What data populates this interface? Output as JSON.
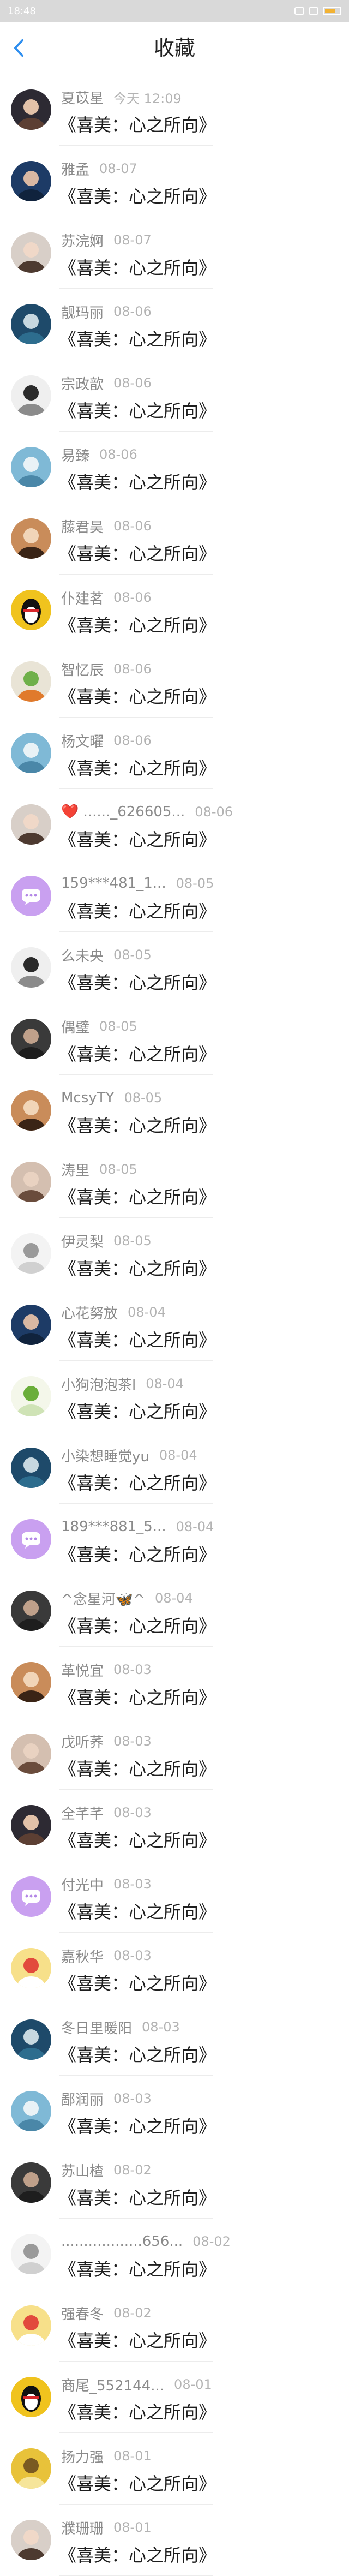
{
  "status_bar": {
    "time": "18:48"
  },
  "nav": {
    "title": "收藏"
  },
  "colors": {
    "accent": "#2f8fef",
    "qq_purple": "#c9a0f0"
  },
  "items": [
    {
      "name": "夏苡星",
      "time": "今天 12:09",
      "title": "《喜美：心之所向》",
      "avatar": "photo-person-icon"
    },
    {
      "name": "雅孟",
      "time": "08-07",
      "title": "《喜美：心之所向》",
      "avatar": "photo-person-icon"
    },
    {
      "name": "苏浣婀",
      "time": "08-07",
      "title": "《喜美：心之所向》",
      "avatar": "photo-person-icon"
    },
    {
      "name": "靓玛丽",
      "time": "08-06",
      "title": "《喜美：心之所向》",
      "avatar": "photo-person-icon"
    },
    {
      "name": "宗政歆",
      "time": "08-06",
      "title": "《喜美：心之所向》",
      "avatar": "photo-person-icon"
    },
    {
      "name": "易臻",
      "time": "08-06",
      "title": "《喜美：心之所向》",
      "avatar": "photo-sea-icon"
    },
    {
      "name": "藤君昊",
      "time": "08-06",
      "title": "《喜美：心之所向》",
      "avatar": "photo-person-icon"
    },
    {
      "name": "仆建茗",
      "time": "08-06",
      "title": "《喜美：心之所向》",
      "avatar": "qq-penguin-icon"
    },
    {
      "name": "智忆辰",
      "time": "08-06",
      "title": "《喜美：心之所向》",
      "avatar": "photo-logo-icon"
    },
    {
      "name": "杨文曜",
      "time": "08-06",
      "title": "《喜美：心之所向》",
      "avatar": "photo-sea-icon"
    },
    {
      "name": "❤️ ......_626605...",
      "time": "08-06",
      "title": "《喜美：心之所向》",
      "avatar": "photo-person-icon"
    },
    {
      "name": "159***481_1...",
      "time": "08-05",
      "title": "《喜美：心之所向》",
      "avatar": "chat-bubble-icon"
    },
    {
      "name": "么未央",
      "time": "08-05",
      "title": "《喜美：心之所向》",
      "avatar": "photo-person-icon"
    },
    {
      "name": "偶璧",
      "time": "08-05",
      "title": "《喜美：心之所向》",
      "avatar": "photo-person-icon"
    },
    {
      "name": "McsyTY",
      "time": "08-05",
      "title": "《喜美：心之所向》",
      "avatar": "photo-person-icon"
    },
    {
      "name": "涛里",
      "time": "08-05",
      "title": "《喜美：心之所向》",
      "avatar": "photo-person-icon"
    },
    {
      "name": "伊灵梨",
      "time": "08-05",
      "title": "《喜美：心之所向》",
      "avatar": "photo-sketch-icon"
    },
    {
      "name": "心花努放",
      "time": "08-04",
      "title": "《喜美：心之所向》",
      "avatar": "photo-person-icon"
    },
    {
      "name": "小狗泡泡茶l",
      "time": "08-04",
      "title": "《喜美：心之所向》",
      "avatar": "photo-plant-icon"
    },
    {
      "name": "小染想睡觉yu",
      "time": "08-04",
      "title": "《喜美：心之所向》",
      "avatar": "photo-person-icon"
    },
    {
      "name": "189***881_5...",
      "time": "08-04",
      "title": "《喜美：心之所向》",
      "avatar": "chat-bubble-icon"
    },
    {
      "name": "^念星河🦋^",
      "time": "08-04",
      "title": "《喜美：心之所向》",
      "avatar": "photo-person-icon"
    },
    {
      "name": "革悦宜",
      "time": "08-03",
      "title": "《喜美：心之所向》",
      "avatar": "photo-person-icon"
    },
    {
      "name": "戊听荞",
      "time": "08-03",
      "title": "《喜美：心之所向》",
      "avatar": "photo-person-icon"
    },
    {
      "name": "全芊芊",
      "time": "08-03",
      "title": "《喜美：心之所向》",
      "avatar": "photo-person-icon"
    },
    {
      "name": "付光中",
      "time": "08-03",
      "title": "《喜美：心之所向》",
      "avatar": "chat-bubble-icon"
    },
    {
      "name": "嘉秋华",
      "time": "08-03",
      "title": "《喜美：心之所向》",
      "avatar": "photo-cartoon-icon"
    },
    {
      "name": "冬日里暖阳",
      "time": "08-03",
      "title": "《喜美：心之所向》",
      "avatar": "photo-person-icon"
    },
    {
      "name": "鄙润丽",
      "time": "08-03",
      "title": "《喜美：心之所向》",
      "avatar": "photo-sea-icon"
    },
    {
      "name": "苏山楂",
      "time": "08-02",
      "title": "《喜美：心之所向》",
      "avatar": "photo-person-icon"
    },
    {
      "name": "..................656...",
      "time": "08-02",
      "title": "《喜美：心之所向》",
      "avatar": "photo-sketch-icon"
    },
    {
      "name": "强春冬",
      "time": "08-02",
      "title": "《喜美：心之所向》",
      "avatar": "photo-cartoon-icon"
    },
    {
      "name": "商尾_552144...",
      "time": "08-01",
      "title": "《喜美：心之所向》",
      "avatar": "qq-penguin-icon"
    },
    {
      "name": "扬力强",
      "time": "08-01",
      "title": "《喜美：心之所向》",
      "avatar": "photo-flower-icon"
    },
    {
      "name": "濮珊珊",
      "time": "08-01",
      "title": "《喜美：心之所向》",
      "avatar": "photo-person-icon"
    }
  ]
}
